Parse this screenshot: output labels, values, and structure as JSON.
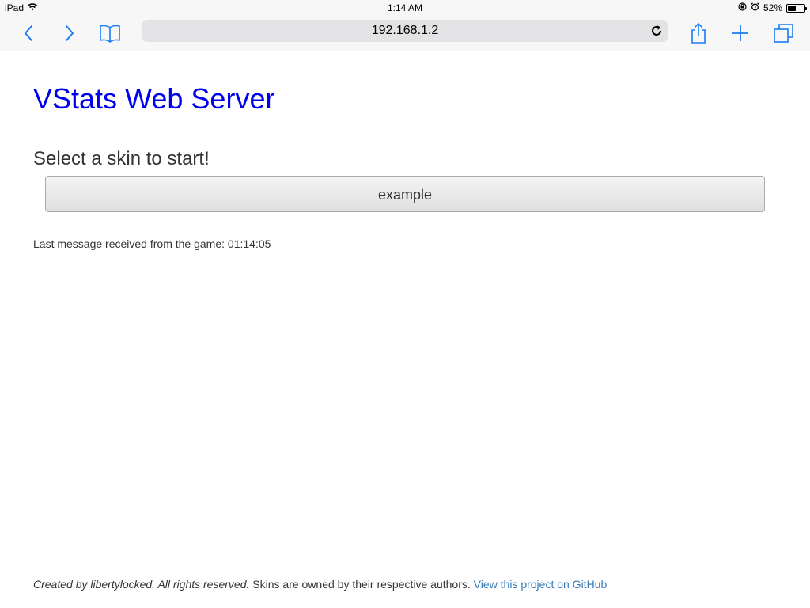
{
  "status_bar": {
    "device": "iPad",
    "time": "1:14 AM",
    "battery_percent": "52%",
    "battery_level": 0.52
  },
  "browser": {
    "url": "192.168.1.2",
    "icons": [
      "back-icon",
      "forward-icon",
      "bookmarks-icon",
      "reload-icon",
      "share-icon",
      "new-tab-icon",
      "tabs-icon"
    ],
    "accent_color": "#1a7cf5"
  },
  "page": {
    "title": "VStats Web Server",
    "title_color": "#0000ee",
    "select_heading": "Select a skin to start!",
    "skins": [
      {
        "label": "example"
      }
    ],
    "last_message_label": "Last message received from the game:",
    "last_message_time": "01:14:05"
  },
  "footer": {
    "credit": "Created by libertylocked. All rights reserved.",
    "skins_note": "Skins are owned by their respective authors.",
    "github_link": "View this project on GitHub",
    "link_color": "#337ab7"
  }
}
